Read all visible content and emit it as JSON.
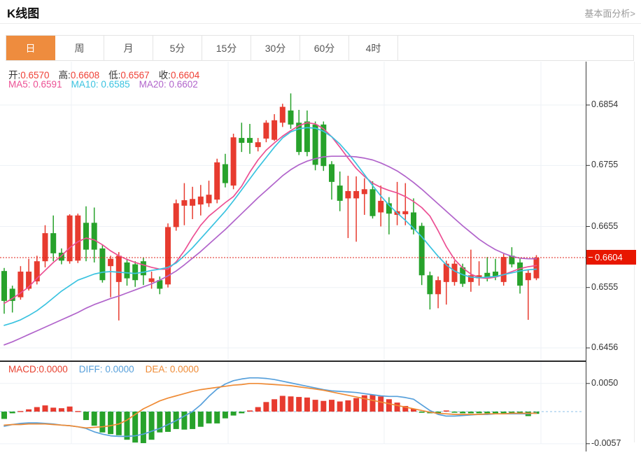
{
  "page": {
    "title": "K线图",
    "analysis_link": "基本面分析>"
  },
  "tabs": {
    "items": [
      "日",
      "周",
      "月",
      "5分",
      "15分",
      "30分",
      "60分",
      "4时"
    ],
    "selected": "日"
  },
  "info": {
    "open_label": "开:",
    "open": "0.6570",
    "high_label": "高:",
    "high": "0.6608",
    "low_label": "低:",
    "low": "0.6567",
    "close_label": "收:",
    "close": "0.6604",
    "ma5_label": "MA5:",
    "ma5": "0.6591",
    "ma10_label": "MA10:",
    "ma10": "0.6585",
    "ma20_label": "MA20:",
    "ma20": "0.6602"
  },
  "macd_info": {
    "macd_label": "MACD:",
    "macd": "0.0000",
    "diff_label": "DIFF:",
    "diff": "0.0000",
    "dea_label": "DEA:",
    "dea": "0.0000"
  },
  "colors": {
    "up_red": "#e73b2f",
    "down_green": "#27a22b",
    "ma5_pink": "#ec4f93",
    "ma10_cyan": "#3ac3e0",
    "ma20_purple": "#b164cb",
    "diff_blue": "#57a0db",
    "dea_orange": "#ef8b35",
    "value_red": "#ef4136",
    "price_tag_red": "#e81600",
    "tab_active_orange": "#ee8c3e",
    "grid": "#edf1f6",
    "zero_line_blue": "#a5cdee"
  },
  "chart_data": {
    "type": "candlestick",
    "title": "K线图",
    "panels": [
      "price",
      "macd"
    ],
    "legend": [
      "MA5",
      "MA10",
      "MA20",
      "MACD",
      "DIFF",
      "DEA"
    ],
    "y_axis_labels": [
      "0.6854",
      "0.6755",
      "0.6655",
      "0.6555",
      "0.6456"
    ],
    "y_axis_values": [
      0.6854,
      0.6755,
      0.6655,
      0.6555,
      0.6456
    ],
    "current_price": 0.6604,
    "current_price_label": "0.6604",
    "candles_format": [
      "open",
      "high",
      "low",
      "close"
    ],
    "candles": [
      [
        0.6582,
        0.6587,
        0.6512,
        0.6533
      ],
      [
        0.6553,
        0.6558,
        0.6514,
        0.6533
      ],
      [
        0.6539,
        0.659,
        0.6535,
        0.6581
      ],
      [
        0.6553,
        0.6602,
        0.655,
        0.6581
      ],
      [
        0.6565,
        0.6607,
        0.656,
        0.6598
      ],
      [
        0.6598,
        0.6657,
        0.6588,
        0.6644
      ],
      [
        0.6644,
        0.6673,
        0.6598,
        0.6611
      ],
      [
        0.6612,
        0.6619,
        0.6593,
        0.6599
      ],
      [
        0.6598,
        0.6675,
        0.6594,
        0.6673
      ],
      [
        0.6599,
        0.6676,
        0.6595,
        0.6673
      ],
      [
        0.6661,
        0.6688,
        0.6598,
        0.6617
      ],
      [
        0.6661,
        0.6686,
        0.6596,
        0.6617
      ],
      [
        0.6619,
        0.6625,
        0.6563,
        0.6567
      ],
      [
        0.659,
        0.6607,
        0.6539,
        0.6602
      ],
      [
        0.6564,
        0.6613,
        0.6501,
        0.6607
      ],
      [
        0.6596,
        0.6602,
        0.6558,
        0.657
      ],
      [
        0.6593,
        0.6598,
        0.6556,
        0.6567
      ],
      [
        0.6598,
        0.6604,
        0.6559,
        0.6575
      ],
      [
        0.6564,
        0.6581,
        0.6553,
        0.657
      ],
      [
        0.6567,
        0.6573,
        0.6544,
        0.6553
      ],
      [
        0.656,
        0.666,
        0.6555,
        0.6654
      ],
      [
        0.6654,
        0.6699,
        0.6648,
        0.6693
      ],
      [
        0.6689,
        0.6726,
        0.6657,
        0.6698
      ],
      [
        0.6689,
        0.672,
        0.6667,
        0.67
      ],
      [
        0.6691,
        0.6723,
        0.6673,
        0.6704
      ],
      [
        0.6693,
        0.673,
        0.6687,
        0.6707
      ],
      [
        0.6699,
        0.6766,
        0.6693,
        0.676
      ],
      [
        0.6757,
        0.6774,
        0.6719,
        0.6726
      ],
      [
        0.6722,
        0.6807,
        0.6716,
        0.6801
      ],
      [
        0.68,
        0.6825,
        0.6777,
        0.6792
      ],
      [
        0.68,
        0.6823,
        0.6774,
        0.6792
      ],
      [
        0.6785,
        0.68,
        0.6778,
        0.6793
      ],
      [
        0.6799,
        0.6829,
        0.6793,
        0.6825
      ],
      [
        0.6797,
        0.6839,
        0.6795,
        0.6829
      ],
      [
        0.6825,
        0.6856,
        0.6818,
        0.6851
      ],
      [
        0.6845,
        0.6873,
        0.6815,
        0.6822
      ],
      [
        0.6825,
        0.6846,
        0.6772,
        0.6777
      ],
      [
        0.6827,
        0.6845,
        0.677,
        0.6777
      ],
      [
        0.6822,
        0.6827,
        0.6747,
        0.6756
      ],
      [
        0.6822,
        0.6827,
        0.6746,
        0.6754
      ],
      [
        0.6757,
        0.6762,
        0.6699,
        0.6728
      ],
      [
        0.6722,
        0.6745,
        0.668,
        0.6697
      ],
      [
        0.6701,
        0.6738,
        0.6636,
        0.6713
      ],
      [
        0.6701,
        0.6737,
        0.663,
        0.6713
      ],
      [
        0.6708,
        0.6734,
        0.6674,
        0.6716
      ],
      [
        0.6716,
        0.6729,
        0.6668,
        0.6672
      ],
      [
        0.6678,
        0.6722,
        0.6655,
        0.6697
      ],
      [
        0.6693,
        0.6703,
        0.6642,
        0.6676
      ],
      [
        0.6674,
        0.6728,
        0.6657,
        0.668
      ],
      [
        0.6675,
        0.6726,
        0.6657,
        0.668
      ],
      [
        0.6678,
        0.6701,
        0.6642,
        0.665
      ],
      [
        0.6656,
        0.6661,
        0.6559,
        0.6575
      ],
      [
        0.6575,
        0.6581,
        0.6519,
        0.6544
      ],
      [
        0.6544,
        0.6573,
        0.6521,
        0.6567
      ],
      [
        0.6564,
        0.6599,
        0.6527,
        0.6594
      ],
      [
        0.6564,
        0.6599,
        0.6558,
        0.6594
      ],
      [
        0.6588,
        0.6594,
        0.6556,
        0.6561
      ],
      [
        0.6564,
        0.6617,
        0.6548,
        0.6575
      ],
      [
        0.657,
        0.6598,
        0.6558,
        0.6575
      ],
      [
        0.6579,
        0.6605,
        0.6565,
        0.6571
      ],
      [
        0.6581,
        0.6602,
        0.6567,
        0.6573
      ],
      [
        0.6564,
        0.661,
        0.6558,
        0.6605
      ],
      [
        0.6607,
        0.6621,
        0.6588,
        0.6593
      ],
      [
        0.6596,
        0.6602,
        0.6545,
        0.6558
      ],
      [
        0.6567,
        0.6584,
        0.6502,
        0.6579
      ],
      [
        0.657,
        0.6608,
        0.6567,
        0.6604
      ]
    ],
    "ma5": [
      0.6529,
      0.6537,
      0.6546,
      0.6556,
      0.657,
      0.6583,
      0.6596,
      0.6607,
      0.662,
      0.663,
      0.6636,
      0.6633,
      0.6625,
      0.6615,
      0.6607,
      0.6601,
      0.6596,
      0.6592,
      0.6588,
      0.6585,
      0.6585,
      0.6597,
      0.6615,
      0.6637,
      0.6657,
      0.6672,
      0.6683,
      0.6694,
      0.6704,
      0.6721,
      0.6744,
      0.6764,
      0.678,
      0.6792,
      0.6803,
      0.6812,
      0.682,
      0.6825,
      0.6823,
      0.6815,
      0.6802,
      0.6785,
      0.6767,
      0.675,
      0.6737,
      0.6726,
      0.6719,
      0.6714,
      0.671,
      0.6704,
      0.6696,
      0.6686,
      0.6672,
      0.6648,
      0.6622,
      0.6601,
      0.6587,
      0.6577,
      0.6571,
      0.657,
      0.6572,
      0.6576,
      0.6581,
      0.6586,
      0.6589,
      0.6591
    ],
    "ma10": [
      0.6493,
      0.6497,
      0.6502,
      0.6509,
      0.6517,
      0.6527,
      0.6538,
      0.6549,
      0.6558,
      0.6567,
      0.6572,
      0.6577,
      0.658,
      0.6581,
      0.658,
      0.6579,
      0.6578,
      0.658,
      0.6583,
      0.6585,
      0.6588,
      0.6595,
      0.6607,
      0.662,
      0.6635,
      0.665,
      0.6665,
      0.668,
      0.6697,
      0.6715,
      0.6733,
      0.6751,
      0.6768,
      0.6785,
      0.68,
      0.681,
      0.6815,
      0.6817,
      0.6816,
      0.6811,
      0.6802,
      0.679,
      0.6775,
      0.6758,
      0.674,
      0.6722,
      0.6705,
      0.669,
      0.6677,
      0.6665,
      0.6652,
      0.6638,
      0.6622,
      0.6606,
      0.6592,
      0.6582,
      0.6576,
      0.6572,
      0.6571,
      0.6572,
      0.6573,
      0.6576,
      0.6579,
      0.6582,
      0.6584,
      0.6585
    ],
    "ma20": [
      0.6461,
      0.6466,
      0.6472,
      0.6478,
      0.6484,
      0.649,
      0.6496,
      0.6502,
      0.6508,
      0.6514,
      0.6521,
      0.6527,
      0.6532,
      0.6537,
      0.6541,
      0.6546,
      0.6551,
      0.6556,
      0.6561,
      0.6567,
      0.6574,
      0.6582,
      0.6592,
      0.6603,
      0.6614,
      0.6626,
      0.6638,
      0.665,
      0.6663,
      0.6676,
      0.6689,
      0.6702,
      0.6714,
      0.6726,
      0.6738,
      0.6748,
      0.6756,
      0.6762,
      0.6766,
      0.6769,
      0.677,
      0.677,
      0.677,
      0.6769,
      0.6767,
      0.6764,
      0.6759,
      0.6753,
      0.6746,
      0.6737,
      0.6727,
      0.6716,
      0.6704,
      0.6692,
      0.668,
      0.6668,
      0.6656,
      0.6645,
      0.6634,
      0.6625,
      0.6617,
      0.6611,
      0.6606,
      0.6603,
      0.6602,
      0.6602
    ],
    "macd_y_axis_labels": [
      "0.0050",
      "-0.0057"
    ],
    "macd_y_axis_values": [
      0.005,
      -0.0057
    ],
    "macd_hist": [
      -0.0013,
      -0.0003,
      0.0001,
      0.0004,
      0.0008,
      0.0011,
      0.0007,
      0.0006,
      0.0009,
      0.0001,
      -0.0015,
      -0.0025,
      -0.0037,
      -0.004,
      -0.0042,
      -0.005,
      -0.0055,
      -0.0056,
      -0.005,
      -0.0037,
      -0.0036,
      -0.0031,
      -0.0032,
      -0.0031,
      -0.0027,
      -0.0021,
      -0.0021,
      -0.0012,
      -0.0007,
      -0.0003,
      0.0002,
      0.0008,
      0.0017,
      0.0022,
      0.0028,
      0.0027,
      0.0026,
      0.0025,
      0.0021,
      0.0019,
      0.0021,
      0.0018,
      0.002,
      0.0024,
      0.0029,
      0.003,
      0.0027,
      0.0022,
      0.0016,
      0.001,
      0.0005,
      -0.0002,
      -0.0003,
      -0.0003,
      0.0002,
      -0.0002,
      -0.0003,
      -0.0003,
      -0.0003,
      -0.0003,
      -0.0003,
      -0.0003,
      -0.0003,
      -0.0002,
      -0.0008,
      -0.0004
    ],
    "diff": [
      -0.0026,
      -0.0023,
      -0.0021,
      -0.002,
      -0.002,
      -0.0021,
      -0.0022,
      -0.0024,
      -0.0025,
      -0.0027,
      -0.003,
      -0.0036,
      -0.004,
      -0.0043,
      -0.0044,
      -0.0044,
      -0.0043,
      -0.004,
      -0.0035,
      -0.003,
      -0.0023,
      -0.0016,
      -0.0008,
      0.0,
      0.0012,
      0.0027,
      0.004,
      0.0049,
      0.0055,
      0.0058,
      0.006,
      0.006,
      0.0059,
      0.0057,
      0.0054,
      0.0051,
      0.0048,
      0.0045,
      0.0042,
      0.0039,
      0.0037,
      0.0036,
      0.0035,
      0.0034,
      0.0032,
      0.003,
      0.0028,
      0.0027,
      0.0027,
      0.0025,
      0.0022,
      0.0012,
      0.0002,
      -0.0005,
      -0.0008,
      -0.0008,
      -0.0007,
      -0.0006,
      -0.0005,
      -0.0005,
      -0.0004,
      -0.0004,
      -0.0004,
      -0.0004,
      -0.0004,
      -0.0002
    ],
    "dea": [
      -0.0024,
      -0.0023,
      -0.0023,
      -0.0022,
      -0.0022,
      -0.0022,
      -0.0023,
      -0.0024,
      -0.0025,
      -0.0027,
      -0.0029,
      -0.0028,
      -0.0027,
      -0.0025,
      -0.0022,
      -0.0015,
      -0.0005,
      0.0005,
      0.0012,
      0.0019,
      0.0024,
      0.0028,
      0.0032,
      0.0036,
      0.0039,
      0.0041,
      0.0043,
      0.0045,
      0.0047,
      0.0048,
      0.005,
      0.005,
      0.0049,
      0.0048,
      0.0047,
      0.0046,
      0.0044,
      0.0042,
      0.004,
      0.0038,
      0.0035,
      0.0032,
      0.0029,
      0.0026,
      0.0023,
      0.002,
      0.0017,
      0.0014,
      0.0011,
      0.0008,
      0.0005,
      0.0002,
      -0.0001,
      -0.0003,
      -0.0004,
      -0.0005,
      -0.0005,
      -0.0005,
      -0.0005,
      -0.0004,
      -0.0004,
      -0.0004,
      -0.0003,
      -0.0003,
      -0.0003,
      -0.0003
    ]
  }
}
